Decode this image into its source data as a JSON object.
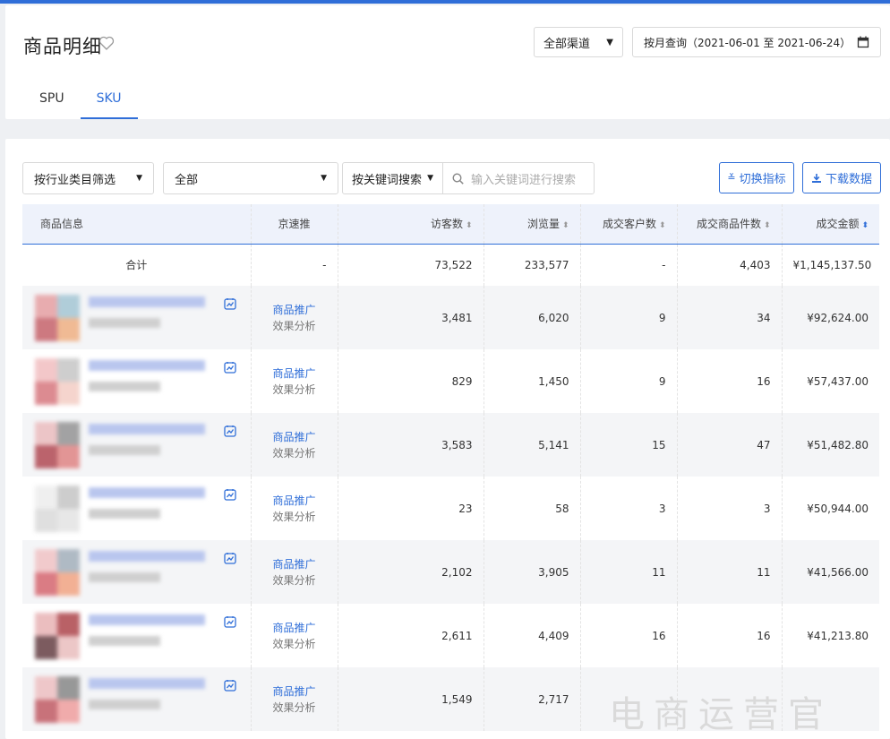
{
  "header": {
    "title": "商品明细",
    "channel": "全部渠道",
    "date_range": "按月查询（2021-06-01 至 2021-06-24）",
    "tabs": [
      "SPU",
      "SKU"
    ],
    "active_tab": "SKU"
  },
  "filters": {
    "industry": "按行业类目筛选",
    "category": "全部",
    "keyword_type": "按关键词搜索",
    "keyword_placeholder": "输入关键词进行搜索",
    "switch_label": "切换指标",
    "download_label": "下载数据"
  },
  "table": {
    "columns": [
      "商品信息",
      "京速推",
      "访客数",
      "浏览量",
      "成交客户数",
      "成交商品件数",
      "成交金额"
    ],
    "summary": {
      "label": "合计",
      "jst": "-",
      "visitors": "73,522",
      "views": "233,577",
      "customers": "-",
      "items": "4,403",
      "amount": "¥1,145,137.50"
    },
    "promo_link": "商品推广",
    "promo_analysis": "效果分析",
    "rows": [
      {
        "visitors": "3,481",
        "views": "6,020",
        "customers": "9",
        "items": "34",
        "amount": "¥92,624.00"
      },
      {
        "visitors": "829",
        "views": "1,450",
        "customers": "9",
        "items": "16",
        "amount": "¥57,437.00"
      },
      {
        "visitors": "3,583",
        "views": "5,141",
        "customers": "15",
        "items": "47",
        "amount": "¥51,482.80"
      },
      {
        "visitors": "23",
        "views": "58",
        "customers": "3",
        "items": "3",
        "amount": "¥50,944.00"
      },
      {
        "visitors": "2,102",
        "views": "3,905",
        "customers": "11",
        "items": "11",
        "amount": "¥41,566.00"
      },
      {
        "visitors": "2,611",
        "views": "4,409",
        "customers": "16",
        "items": "16",
        "amount": "¥41,213.80"
      },
      {
        "visitors": "1,549",
        "views": "2,717",
        "customers": "",
        "items": "",
        "amount": ""
      }
    ]
  },
  "watermark": "电商运营官",
  "colors": {
    "accent": "#2f6ed8",
    "header_bg": "#eef2fb",
    "stripe": "#f4f5f7"
  }
}
